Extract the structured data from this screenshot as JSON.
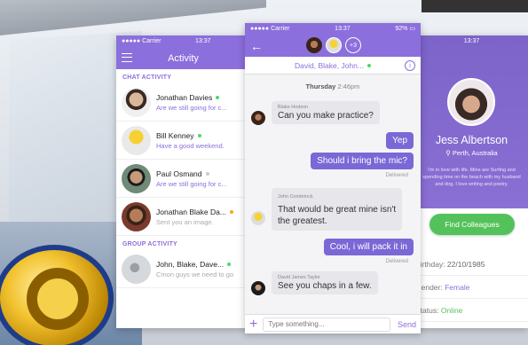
{
  "colors": {
    "accent": "#8b6fdc",
    "bubble_out": "#7b68d6",
    "online": "#4cd964",
    "away": "#f5a623",
    "button": "#54c25a"
  },
  "activity": {
    "status": {
      "carrier": "●●●●● Carrier",
      "time": "13:37"
    },
    "title": "Activity",
    "sections": {
      "chat": "CHAT ACTIVITY",
      "group": "GROUP ACTIVITY"
    },
    "chats": [
      {
        "name": "Jonathan Davies",
        "preview": "Are we still going for c...",
        "status": "online"
      },
      {
        "name": "Bill Kenney",
        "preview": "Have a good weekend.",
        "status": "online"
      },
      {
        "name": "Paul Osmand",
        "preview": "Are we still going for c...",
        "status": "offline"
      },
      {
        "name": "Jonathan Blake Da...",
        "preview": "Sent you an image.",
        "status": "away"
      },
      {
        "name": "John, Blake, Dave...",
        "preview": "Cmon guys we need to go",
        "status": "online"
      }
    ]
  },
  "chat": {
    "status": {
      "carrier": "●●●●● Carrier",
      "time": "13:37",
      "battery": "92%"
    },
    "participants_more": "+3",
    "title": "David, Blake, John...",
    "day": "Thursday",
    "day_time": "2:46pm",
    "messages": [
      {
        "sender": "Blake Hodson",
        "text": "Can you make practice?",
        "dir": "in"
      },
      {
        "text": "Yep",
        "dir": "out"
      },
      {
        "text": "Should i bring the mic?",
        "dir": "out",
        "status": "Delivered"
      },
      {
        "sender": "John Combrinck",
        "text": "That would be great mine isn't",
        "text2": "the greatest.",
        "dir": "in"
      },
      {
        "text": "Cool, i will pack it in",
        "dir": "out",
        "status": "Delivered"
      },
      {
        "sender": "David James Taylor",
        "text": "See you chaps in a few.",
        "dir": "in"
      }
    ],
    "input_placeholder": "Type something...",
    "send_label": "Send"
  },
  "profile": {
    "status": {
      "time": "13:37"
    },
    "name": "Jess Albertson",
    "location": "Perth, Australia",
    "bio": "I'm in love with life. Mine are Surfing and spending time on the beach with my husband and dog. I love writing and poetry.",
    "button": "Find Colleagues",
    "rows": [
      {
        "label": "Birthday:",
        "value": "22/10/1985"
      },
      {
        "label": "Gender:",
        "value": "Female"
      },
      {
        "label": "Status:",
        "value": "Online"
      }
    ]
  }
}
